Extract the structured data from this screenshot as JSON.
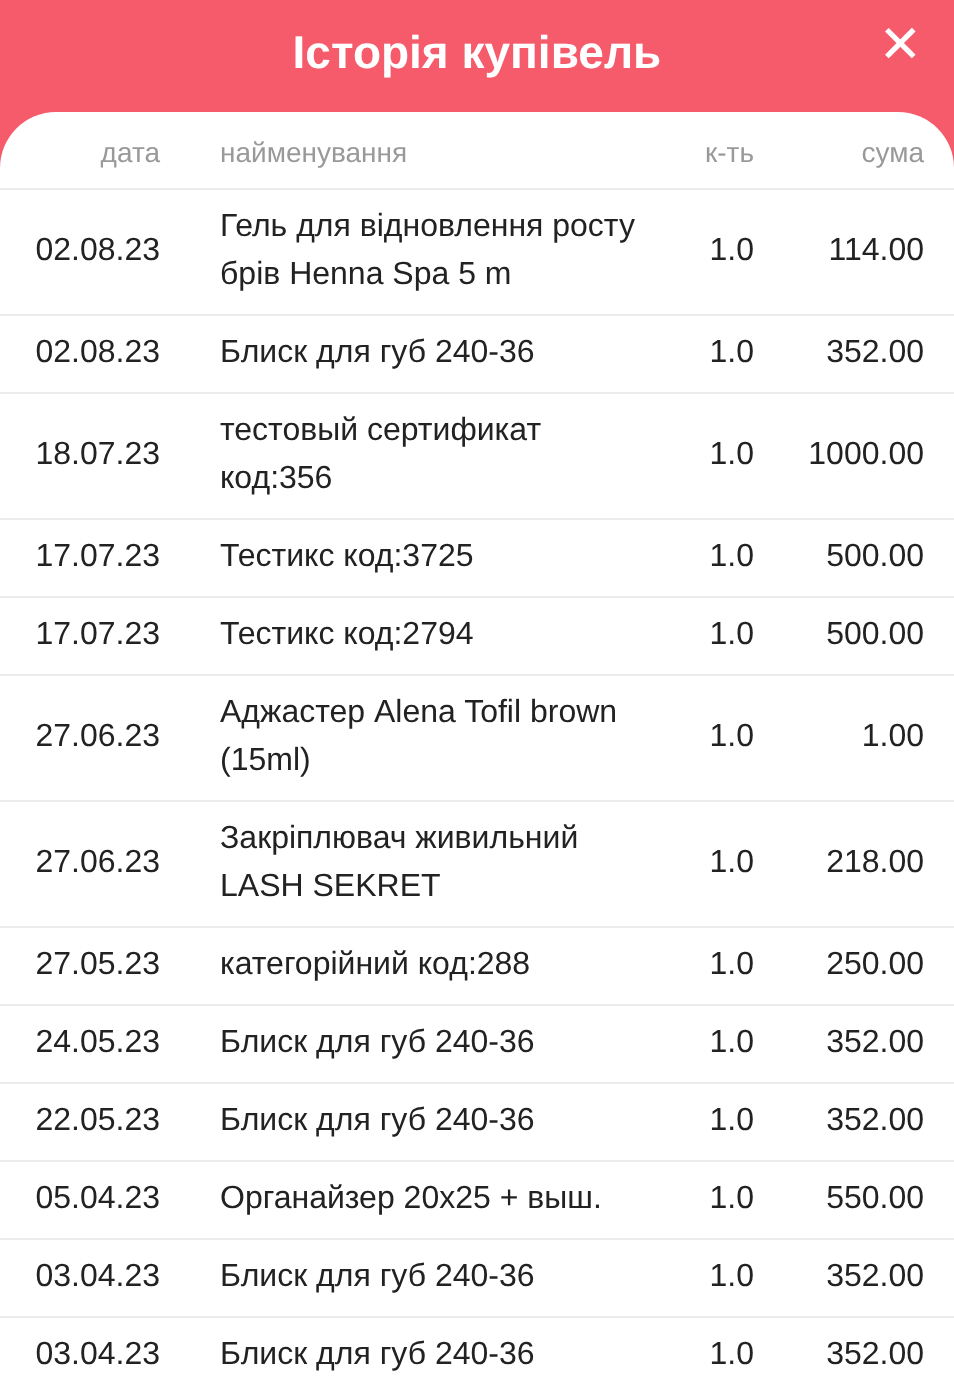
{
  "header": {
    "title": "Історія купівель",
    "close": "✕"
  },
  "table": {
    "columns": [
      "дата",
      "найменування",
      "к-ть",
      "сума"
    ],
    "rows": [
      {
        "date": "02.08.23",
        "name": "Гель для відновлення росту брів Henna Spa 5 m",
        "qty": "1.0",
        "sum": "114.00"
      },
      {
        "date": "02.08.23",
        "name": "Блиск для губ 240-36",
        "qty": "1.0",
        "sum": "352.00"
      },
      {
        "date": "18.07.23",
        "name": "тестовый сертификат код:356",
        "qty": "1.0",
        "sum": "1000.00"
      },
      {
        "date": "17.07.23",
        "name": "Тестикс код:3725",
        "qty": "1.0",
        "sum": "500.00"
      },
      {
        "date": "17.07.23",
        "name": "Тестикс код:2794",
        "qty": "1.0",
        "sum": "500.00"
      },
      {
        "date": "27.06.23",
        "name": "Аджастер Alena Tofil brown (15ml)",
        "qty": "1.0",
        "sum": "1.00"
      },
      {
        "date": "27.06.23",
        "name": "Закріплювач живильний LASH SEKRET",
        "qty": "1.0",
        "sum": "218.00"
      },
      {
        "date": "27.05.23",
        "name": "категорійний код:288",
        "qty": "1.0",
        "sum": "250.00"
      },
      {
        "date": "24.05.23",
        "name": "Блиск для губ 240-36",
        "qty": "1.0",
        "sum": "352.00"
      },
      {
        "date": "22.05.23",
        "name": "Блиск для губ 240-36",
        "qty": "1.0",
        "sum": "352.00"
      },
      {
        "date": "05.04.23",
        "name": "Органайзер 20х25 + выш.",
        "qty": "1.0",
        "sum": "550.00"
      },
      {
        "date": "03.04.23",
        "name": "Блиск для губ 240-36",
        "qty": "1.0",
        "sum": "352.00"
      },
      {
        "date": "03.04.23",
        "name": "Блиск для губ 240-36",
        "qty": "1.0",
        "sum": "352.00"
      }
    ]
  }
}
